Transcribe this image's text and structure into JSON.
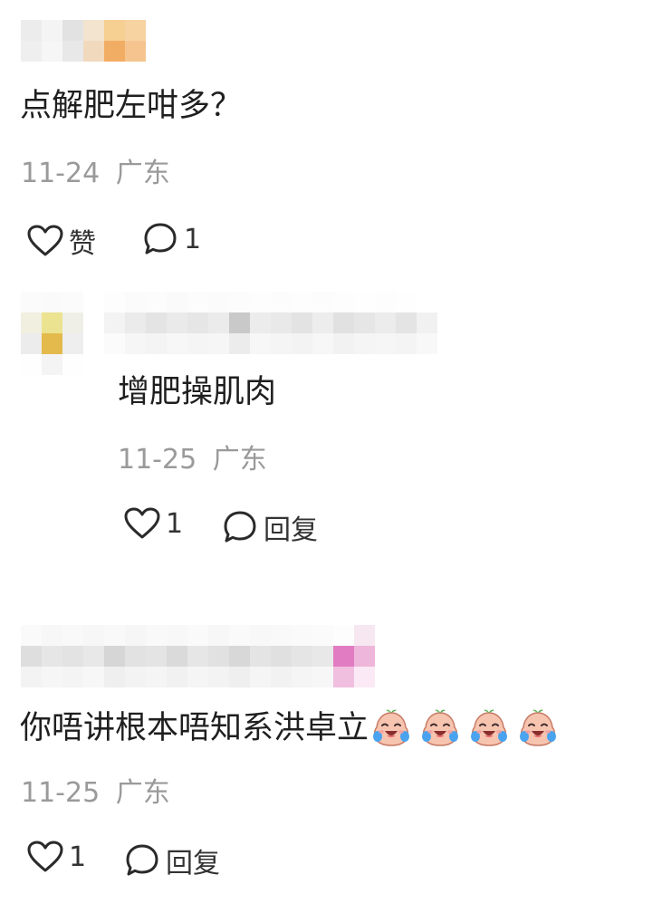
{
  "colors": {
    "text_primary": "#1f1f1f",
    "text_meta": "#9a9a9a",
    "icon_stroke": "#2a2a2a",
    "blur_gray": "#e3e3e3",
    "blur_orange": "#f6b66e",
    "blur_yellow": "#e4c14a",
    "blur_pink": "#ea9fcf"
  },
  "comments": [
    {
      "text": "点解肥左咁多？",
      "date": "11-24",
      "location": "广东",
      "like_label": "赞",
      "reply_label": "1",
      "like_icon": "heart-outline-icon",
      "reply_icon": "speech-bubble-icon"
    },
    {
      "text": "增肥操肌肉",
      "date": "11-25",
      "location": "广东",
      "like_label": "1",
      "reply_label": "回复",
      "like_icon": "heart-outline-icon",
      "reply_icon": "speech-bubble-icon"
    },
    {
      "text": "你唔讲根本唔知系洪卓立",
      "date": "11-25",
      "location": "广东",
      "like_label": "1",
      "reply_label": "回复",
      "like_icon": "heart-outline-icon",
      "reply_icon": "speech-bubble-icon",
      "emoji_icon": "crying-laughing-face-icon",
      "emoji_count": 4
    }
  ]
}
